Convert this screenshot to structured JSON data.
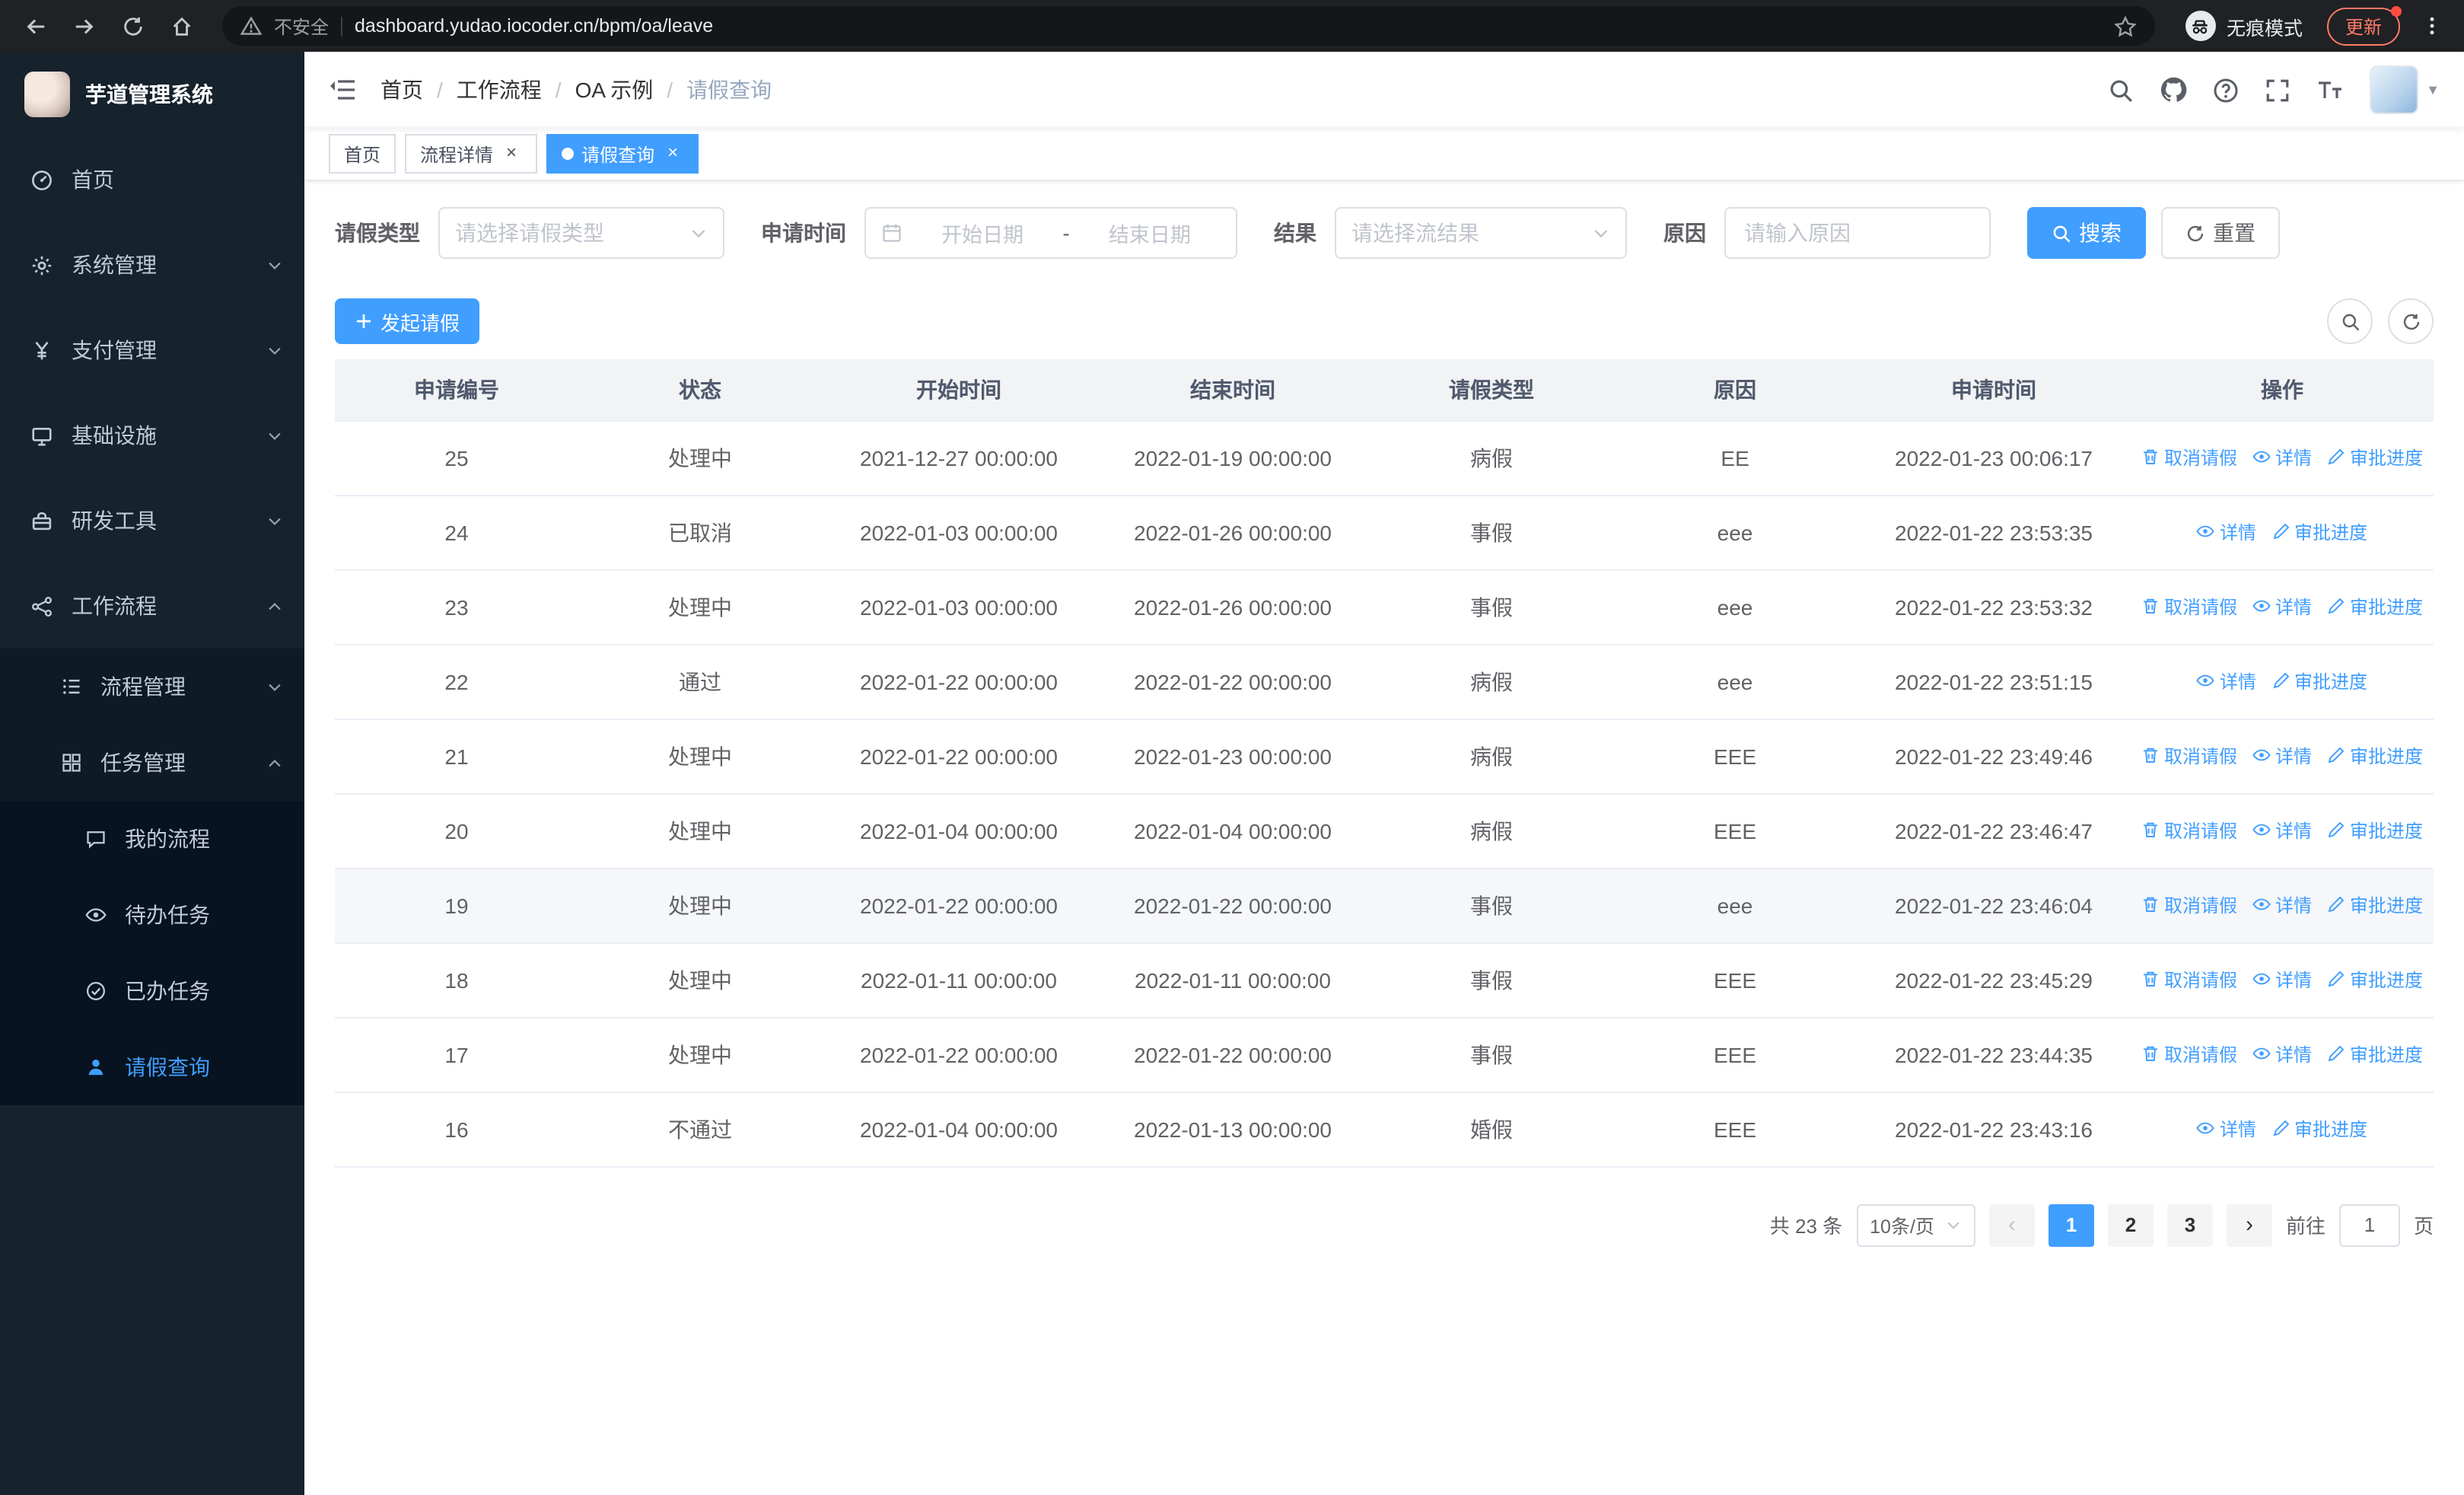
{
  "colors": {
    "primary": "#409eff",
    "sidebar_bg": "#16222c",
    "chrome_bg": "#202124"
  },
  "browser": {
    "security_label": "不安全",
    "url": "dashboard.yudao.iocoder.cn/bpm/oa/leave",
    "incognito_label": "无痕模式",
    "update_label": "更新"
  },
  "sidebar": {
    "app_title": "芋道管理系统",
    "items": [
      {
        "label": "首页"
      },
      {
        "label": "系统管理"
      },
      {
        "label": "支付管理"
      },
      {
        "label": "基础设施"
      },
      {
        "label": "研发工具"
      },
      {
        "label": "工作流程",
        "children": [
          {
            "label": "流程管理"
          },
          {
            "label": "任务管理",
            "children": [
              {
                "label": "我的流程"
              },
              {
                "label": "待办任务"
              },
              {
                "label": "已办任务"
              },
              {
                "label": "请假查询"
              }
            ]
          }
        ]
      }
    ]
  },
  "breadcrumb": {
    "items": [
      "首页",
      "工作流程",
      "OA 示例",
      "请假查询"
    ]
  },
  "tabs": [
    {
      "label": "首页",
      "closable": false,
      "active": false
    },
    {
      "label": "流程详情",
      "closable": true,
      "active": false
    },
    {
      "label": "请假查询",
      "closable": true,
      "active": true
    }
  ],
  "filters": {
    "leave_type_label": "请假类型",
    "leave_type_placeholder": "请选择请假类型",
    "apply_time_label": "申请时间",
    "start_date_placeholder": "开始日期",
    "range_separator": "-",
    "end_date_placeholder": "结束日期",
    "result_label": "结果",
    "result_placeholder": "请选择流结果",
    "reason_label": "原因",
    "reason_placeholder": "请输入原因",
    "search_label": "搜索",
    "reset_label": "重置"
  },
  "toolbar": {
    "create_label": "发起请假"
  },
  "table": {
    "columns": [
      "申请编号",
      "状态",
      "开始时间",
      "结束时间",
      "请假类型",
      "原因",
      "申请时间",
      "操作"
    ],
    "action_labels": {
      "cancel": "取消请假",
      "detail": "详情",
      "progress": "审批进度"
    },
    "rows": [
      {
        "id": "25",
        "status": "处理中",
        "start": "2021-12-27 00:00:00",
        "end": "2022-01-19 00:00:00",
        "type": "病假",
        "reason": "EE",
        "apply_time": "2022-01-23 00:06:17",
        "actions": [
          "cancel",
          "detail",
          "progress"
        ],
        "highlight": false
      },
      {
        "id": "24",
        "status": "已取消",
        "start": "2022-01-03 00:00:00",
        "end": "2022-01-26 00:00:00",
        "type": "事假",
        "reason": "eee",
        "apply_time": "2022-01-22 23:53:35",
        "actions": [
          "detail",
          "progress"
        ],
        "highlight": false
      },
      {
        "id": "23",
        "status": "处理中",
        "start": "2022-01-03 00:00:00",
        "end": "2022-01-26 00:00:00",
        "type": "事假",
        "reason": "eee",
        "apply_time": "2022-01-22 23:53:32",
        "actions": [
          "cancel",
          "detail",
          "progress"
        ],
        "highlight": false
      },
      {
        "id": "22",
        "status": "通过",
        "start": "2022-01-22 00:00:00",
        "end": "2022-01-22 00:00:00",
        "type": "病假",
        "reason": "eee",
        "apply_time": "2022-01-22 23:51:15",
        "actions": [
          "detail",
          "progress"
        ],
        "highlight": false
      },
      {
        "id": "21",
        "status": "处理中",
        "start": "2022-01-22 00:00:00",
        "end": "2022-01-23 00:00:00",
        "type": "病假",
        "reason": "EEE",
        "apply_time": "2022-01-22 23:49:46",
        "actions": [
          "cancel",
          "detail",
          "progress"
        ],
        "highlight": false
      },
      {
        "id": "20",
        "status": "处理中",
        "start": "2022-01-04 00:00:00",
        "end": "2022-01-04 00:00:00",
        "type": "病假",
        "reason": "EEE",
        "apply_time": "2022-01-22 23:46:47",
        "actions": [
          "cancel",
          "detail",
          "progress"
        ],
        "highlight": false
      },
      {
        "id": "19",
        "status": "处理中",
        "start": "2022-01-22 00:00:00",
        "end": "2022-01-22 00:00:00",
        "type": "事假",
        "reason": "eee",
        "apply_time": "2022-01-22 23:46:04",
        "actions": [
          "cancel",
          "detail",
          "progress"
        ],
        "highlight": true
      },
      {
        "id": "18",
        "status": "处理中",
        "start": "2022-01-11 00:00:00",
        "end": "2022-01-11 00:00:00",
        "type": "事假",
        "reason": "EEE",
        "apply_time": "2022-01-22 23:45:29",
        "actions": [
          "cancel",
          "detail",
          "progress"
        ],
        "highlight": false
      },
      {
        "id": "17",
        "status": "处理中",
        "start": "2022-01-22 00:00:00",
        "end": "2022-01-22 00:00:00",
        "type": "事假",
        "reason": "EEE",
        "apply_time": "2022-01-22 23:44:35",
        "actions": [
          "cancel",
          "detail",
          "progress"
        ],
        "highlight": false
      },
      {
        "id": "16",
        "status": "不通过",
        "start": "2022-01-04 00:00:00",
        "end": "2022-01-13 00:00:00",
        "type": "婚假",
        "reason": "EEE",
        "apply_time": "2022-01-22 23:43:16",
        "actions": [
          "detail",
          "progress"
        ],
        "highlight": false
      }
    ]
  },
  "pagination": {
    "total_label": "共 23 条",
    "page_size_label": "10条/页",
    "pages": [
      "1",
      "2",
      "3"
    ],
    "active_page": "1",
    "goto_label": "前往",
    "goto_value": "1",
    "page_suffix": "页"
  }
}
